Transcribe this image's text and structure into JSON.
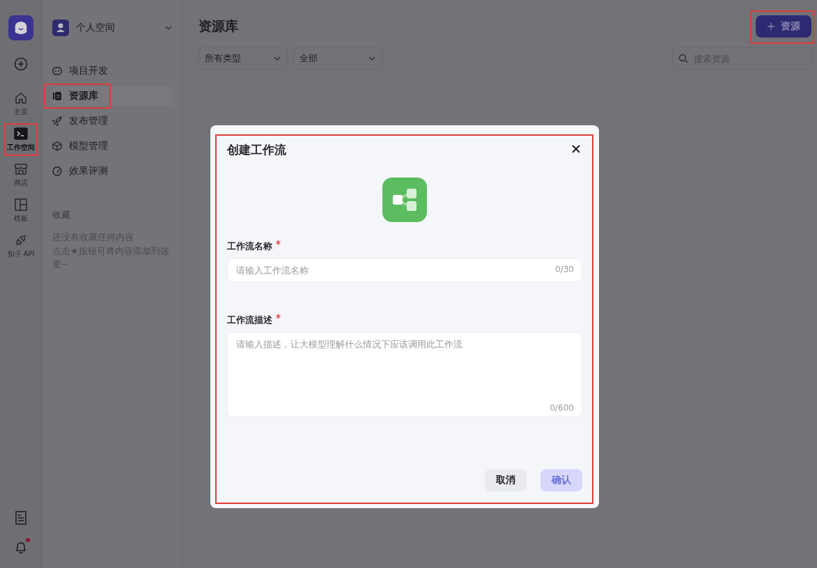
{
  "rail": {
    "items": [
      {
        "label": "主页",
        "selected": false,
        "highlighted": false
      },
      {
        "label": "工作空间",
        "selected": true,
        "highlighted": true
      },
      {
        "label": "商店",
        "selected": false,
        "highlighted": false
      },
      {
        "label": "模板",
        "selected": false,
        "highlighted": false
      },
      {
        "label": "扣子 API",
        "selected": false,
        "highlighted": false
      }
    ],
    "notifications": {
      "unread": true
    }
  },
  "sidebar": {
    "space": "个人空间",
    "items": [
      {
        "label": "项目开发",
        "selected": false,
        "highlighted": false
      },
      {
        "label": "资源库",
        "selected": true,
        "highlighted": true
      },
      {
        "label": "发布管理",
        "selected": false,
        "highlighted": false
      },
      {
        "label": "模型管理",
        "selected": false,
        "highlighted": false
      },
      {
        "label": "效果评测",
        "selected": false,
        "highlighted": false
      }
    ],
    "favorites": {
      "title": "收藏",
      "empty_line": "还没有收藏任何内容",
      "hint": "点击★按钮可将内容添加到这里~"
    }
  },
  "main": {
    "title": "资源库",
    "add_button": {
      "label": "资源",
      "highlighted": true
    },
    "filters": [
      "所有类型",
      "全部"
    ],
    "search": {
      "placeholder": "搜索资源"
    }
  },
  "modal": {
    "title": "创建工作流",
    "highlighted": true,
    "fields": [
      {
        "kind": "input",
        "label": "工作流名称",
        "required": true,
        "placeholder": "请输入工作流名称",
        "counter": "0/30"
      },
      {
        "kind": "textarea",
        "label": "工作流描述",
        "required": true,
        "placeholder": "请输入描述，让大模型理解什么情况下应该调用此工作流",
        "counter": "0/600"
      }
    ],
    "buttons": [
      {
        "kind": "secondary",
        "label": "取消",
        "disabled": false
      },
      {
        "kind": "primary",
        "label": "确认",
        "disabled": true
      }
    ]
  }
}
